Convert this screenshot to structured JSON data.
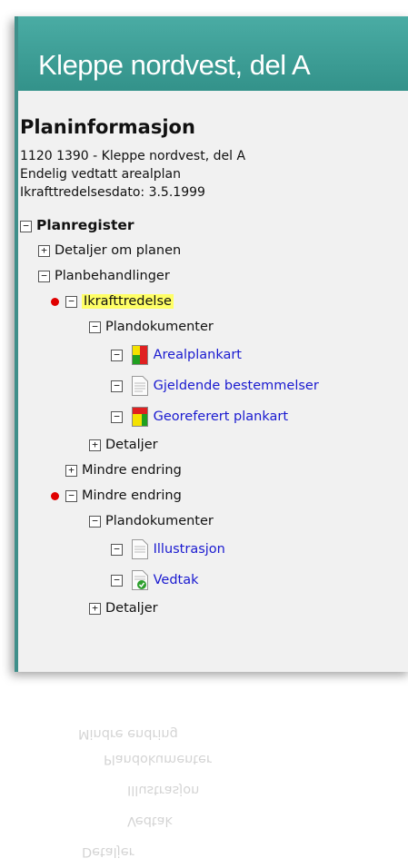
{
  "header": {
    "title": "Kleppe nordvest, del A"
  },
  "info": {
    "heading": "Planinformasjon",
    "line1": "1120 1390 - Kleppe nordvest, del A",
    "line2": "Endelig vedtatt arealplan",
    "line3": "Ikrafttredelsesdato: 3.5.1999"
  },
  "tree": {
    "root": "Planregister",
    "detaljer_om_planen": "Detaljer om planen",
    "planbehandlinger": "Planbehandlinger",
    "ikrafttredelse": "Ikrafttredelse",
    "plandokumenter1": "Plandokumenter",
    "arealplankart": "Arealplankart",
    "gjeldende_bestemmelser": "Gjeldende bestemmelser",
    "georeferert_plankart": "Georeferert plankart",
    "detaljer1": "Detaljer",
    "mindre_endring1": "Mindre endring",
    "mindre_endring2": "Mindre endring",
    "plandokumenter2": "Plandokumenter",
    "illustrasjon": "Illustrasjon",
    "vedtak": "Vedtak",
    "detaljer2": "Detaljer"
  },
  "colors": {
    "header_bg": "#3c9c94",
    "link": "#1a1ad0",
    "highlight": "#ffff66",
    "status_dot": "#e00000"
  }
}
